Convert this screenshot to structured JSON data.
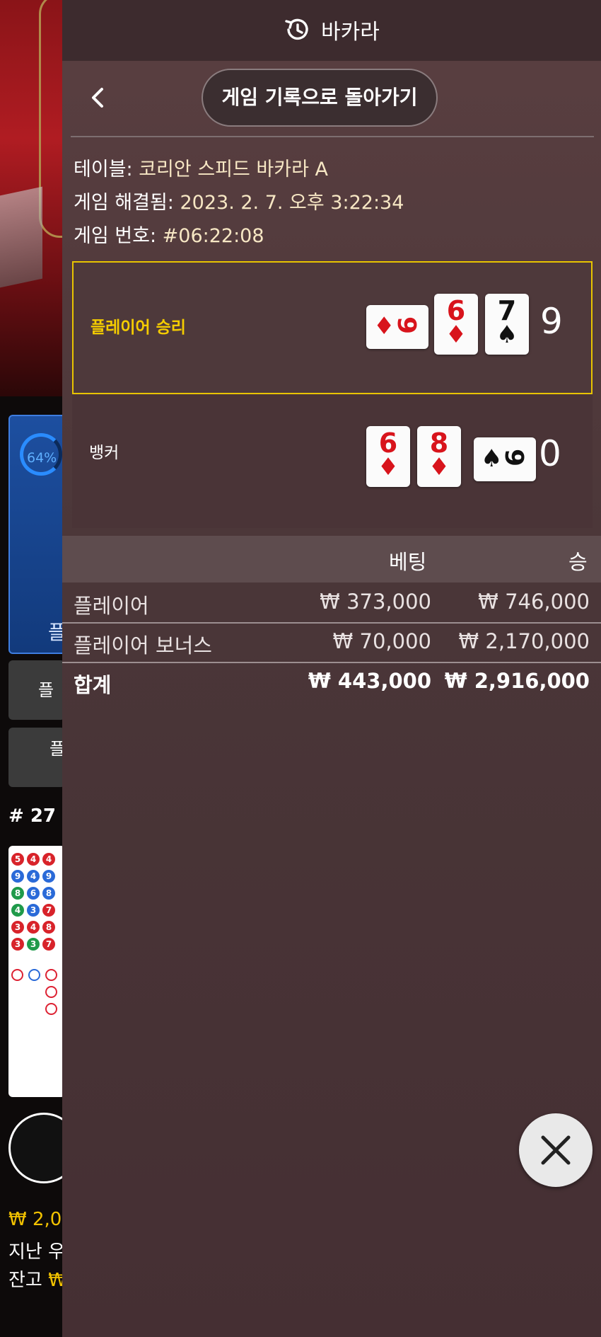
{
  "background": {
    "progress_percent": "64%",
    "player_bet_label": "플",
    "button_1": "플",
    "button_2": "플",
    "round_label": "# 27",
    "road_numbers": [
      [
        "5",
        "4",
        "4"
      ],
      [
        "9",
        "4",
        "9"
      ],
      [
        "8",
        "6",
        "8"
      ],
      [
        "4",
        "3",
        "7"
      ],
      [
        "3",
        "4",
        "8"
      ],
      [
        "3",
        "3",
        "7"
      ]
    ],
    "balance_line_1": "₩ 2,0",
    "balance_line_2": "지난 우",
    "balance_line_3_label": "잔고",
    "balance_line_3_value": "₩"
  },
  "header": {
    "title": "바카라",
    "history_icon": "history-clock-icon"
  },
  "nav": {
    "back_icon": "chevron-left-icon",
    "back_button_label": "게임 기록으로 돌아가기"
  },
  "details": {
    "table_label": "테이블:",
    "table_value": "코리안 스피드 바카라 A",
    "resolved_label": "게임 해결됨:",
    "resolved_value": "2023. 2. 7. 오후 3:22:34",
    "game_no_label": "게임 번호:",
    "game_no_value": "#06:22:08"
  },
  "results": {
    "player": {
      "label": "플레이어 승리",
      "score": "9",
      "cards": [
        {
          "rank": "9",
          "suit": "♦",
          "color": "red",
          "orientation": "horizontal"
        },
        {
          "rank": "6",
          "suit": "♦",
          "color": "red",
          "orientation": "vertical"
        },
        {
          "rank": "7",
          "suit": "♠",
          "color": "black",
          "orientation": "vertical"
        }
      ]
    },
    "banker": {
      "label": "뱅커",
      "score": "0",
      "cards": [
        {
          "rank": "6",
          "suit": "♦",
          "color": "red",
          "orientation": "vertical"
        },
        {
          "rank": "8",
          "suit": "♦",
          "color": "red",
          "orientation": "vertical"
        },
        {
          "rank": "9",
          "suit": "♠",
          "color": "black",
          "orientation": "horizontal"
        }
      ]
    }
  },
  "bets_table": {
    "headers": {
      "bet": "베팅",
      "win": "승"
    },
    "rows": [
      {
        "name": "플레이어",
        "bet": "₩ 373,000",
        "win": "₩ 746,000"
      },
      {
        "name": "플레이어 보너스",
        "bet": "₩ 70,000",
        "win": "₩ 2,170,000"
      }
    ],
    "total": {
      "name": "합계",
      "bet": "₩ 443,000",
      "win": "₩ 2,916,000"
    }
  },
  "close_icon": "close-x-icon",
  "colors": {
    "accent_gold": "#e8c400",
    "red_suit": "#d8141c",
    "panel_bg": "#4a3638"
  }
}
